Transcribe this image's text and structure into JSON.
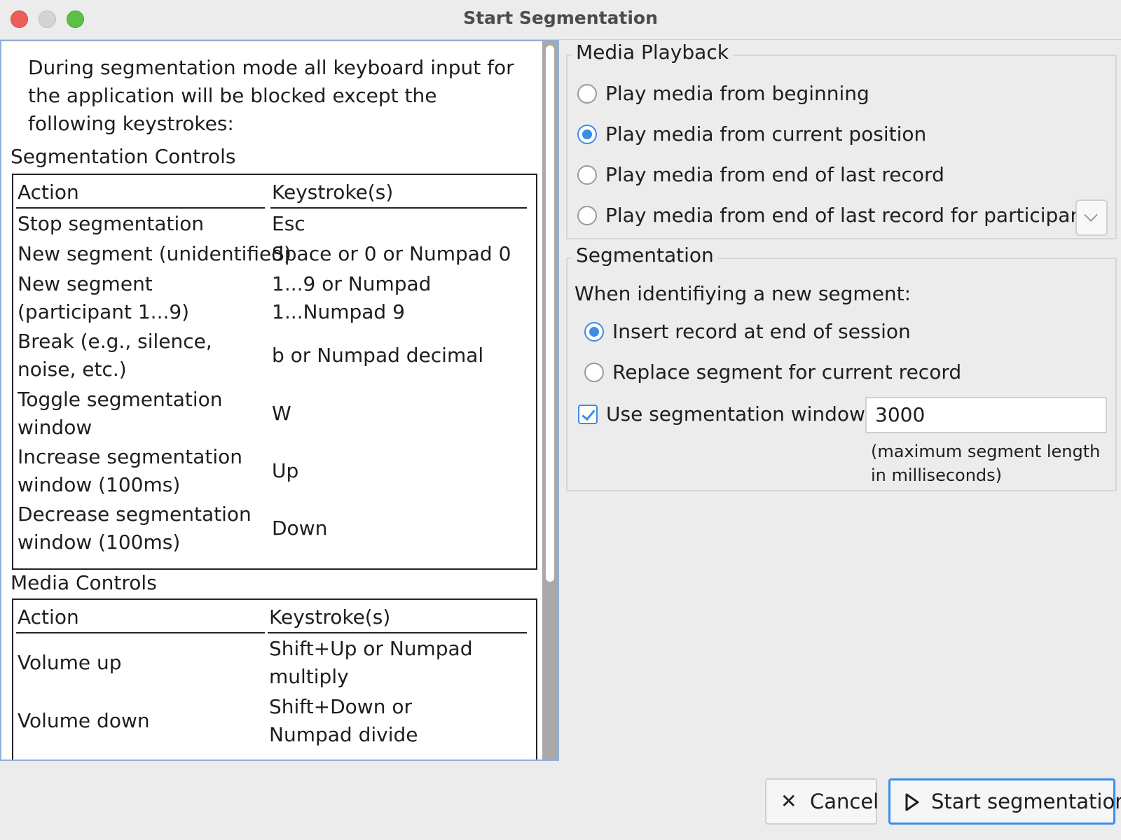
{
  "window": {
    "title": "Start Segmentation"
  },
  "left": {
    "intro": "During segmentation mode all keyboard input for the application will be blocked except the following keystrokes:",
    "segmentation_controls": {
      "title": "Segmentation Controls",
      "headers": [
        "Action",
        "Keystroke(s)"
      ],
      "rows": [
        [
          "Stop segmentation",
          "Esc"
        ],
        [
          "New segment (unidentified)",
          "Space or 0 or Numpad 0"
        ],
        [
          "New segment (participant 1...9)",
          "1...9 or Numpad 1...Numpad 9"
        ],
        [
          "Break (e.g., silence, noise, etc.)",
          "b or Numpad decimal"
        ],
        [
          "Toggle segmentation window",
          "W"
        ],
        [
          "Increase segmentation window (100ms)",
          "Up"
        ],
        [
          "Decrease segmentation window (100ms)",
          "Down"
        ]
      ]
    },
    "media_controls": {
      "title": "Media Controls",
      "headers": [
        "Action",
        "Keystroke(s)"
      ],
      "rows": [
        [
          "Volume up",
          "Shift+Up or Numpad multiply"
        ],
        [
          "Volume down",
          "Shift+Down or Numpad divide"
        ]
      ]
    }
  },
  "media_playback": {
    "title": "Media Playback",
    "options": [
      {
        "label": "Play media from beginning",
        "selected": false
      },
      {
        "label": "Play media from current position",
        "selected": true
      },
      {
        "label": "Play media from end of last record",
        "selected": false
      },
      {
        "label": "Play media from end of last record for participant",
        "selected": false
      }
    ],
    "participant_dropdown_icon": "chevron-down-icon"
  },
  "segmentation": {
    "title": "Segmentation",
    "prompt": "When identifiying a new segment:",
    "options": [
      {
        "label": "Insert record at end of session",
        "selected": true
      },
      {
        "label": "Replace segment for current record",
        "selected": false
      }
    ],
    "window_checkbox_label": "Use segmentation window",
    "window_checked": true,
    "window_value": "3000",
    "window_hint": "(maximum segment length in milliseconds)"
  },
  "buttons": {
    "cancel": "Cancel",
    "cancel_icon": "close-icon",
    "start": "Start segmentation",
    "start_icon": "play-icon"
  },
  "colors": {
    "accent": "#3b8de8",
    "close": "#ec5f57",
    "maximize": "#5bc043"
  }
}
